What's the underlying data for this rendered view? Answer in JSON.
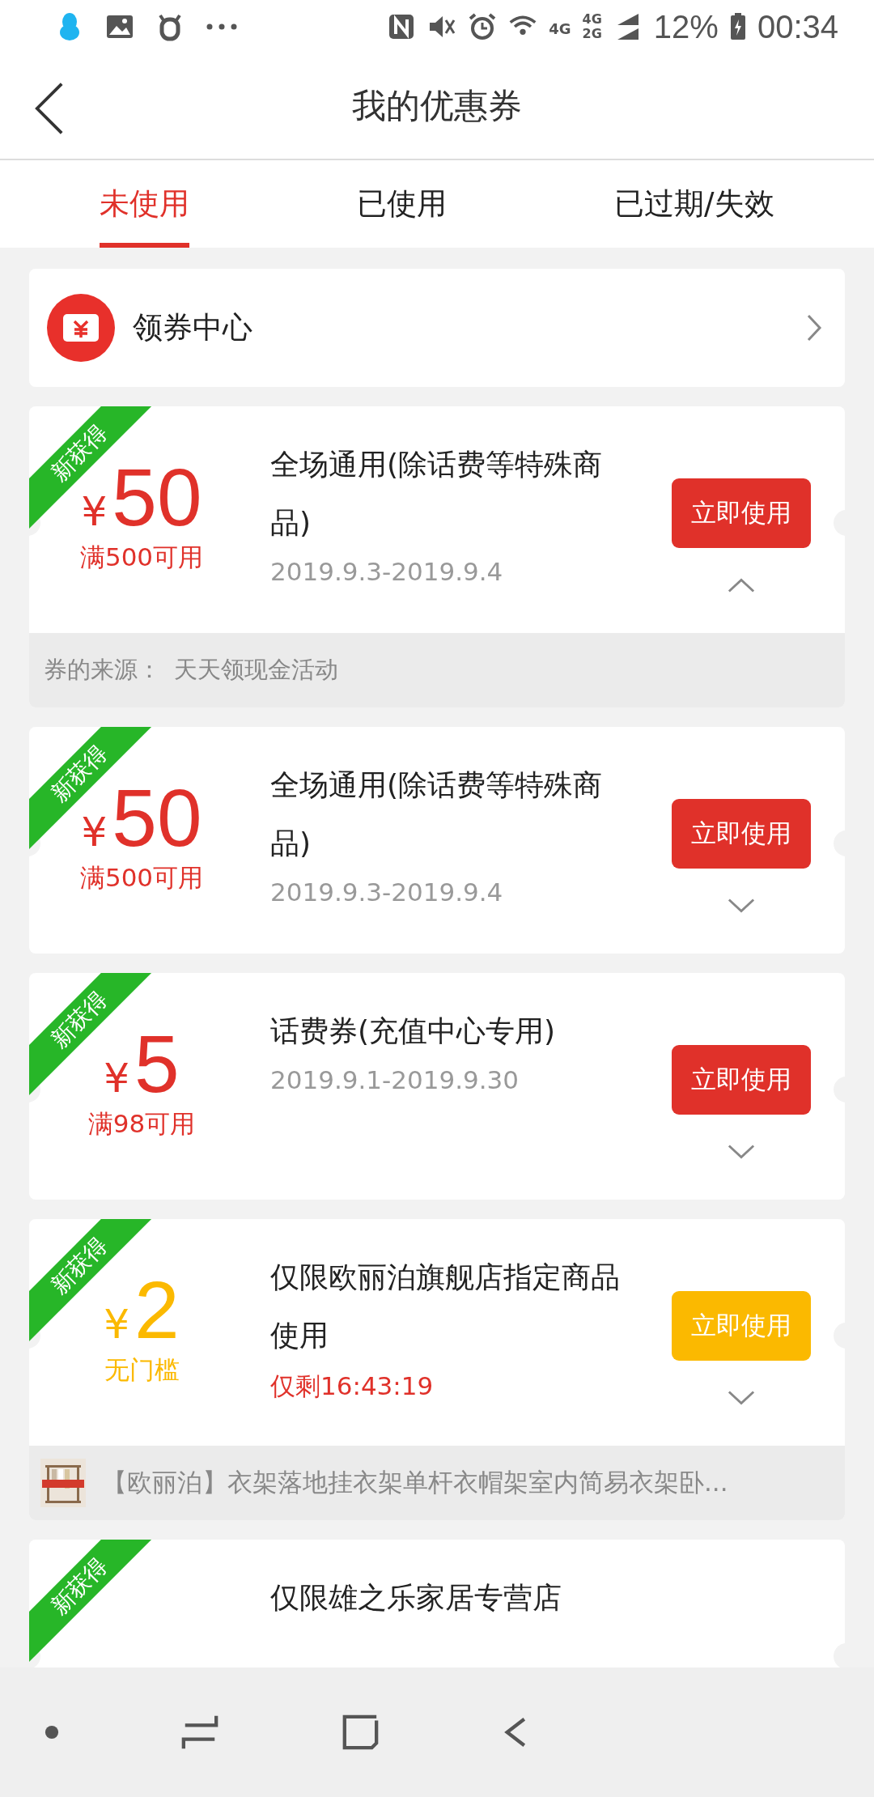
{
  "status_bar": {
    "network_primary": "4G",
    "network_secondary": [
      "4G",
      "2G"
    ],
    "battery": "12%",
    "time": "00:34"
  },
  "header": {
    "title": "我的优惠券"
  },
  "tabs": [
    {
      "label": "未使用",
      "selected": true
    },
    {
      "label": "已使用",
      "selected": false
    },
    {
      "label": "已过期/失效",
      "selected": false
    }
  ],
  "coupon_center": {
    "label": "领券中心"
  },
  "coupons": [
    {
      "badge": "新获得",
      "color": "#e0312a",
      "currency": "¥",
      "amount": "50",
      "condition": "满500可用",
      "title": "全场通用(除话费等特殊商品)",
      "date": "2019.9.3-2019.9.4",
      "button": "立即使用",
      "expanded": true,
      "footer": {
        "kind": "source",
        "label": "券的来源：",
        "value": "天天领现金活动"
      }
    },
    {
      "badge": "新获得",
      "color": "#e0312a",
      "currency": "¥",
      "amount": "50",
      "condition": "满500可用",
      "title": "全场通用(除话费等特殊商品)",
      "date": "2019.9.3-2019.9.4",
      "button": "立即使用",
      "expanded": false
    },
    {
      "badge": "新获得",
      "color": "#e0312a",
      "currency": "¥",
      "amount": "5",
      "condition": "满98可用",
      "title": "话费券(充值中心专用)",
      "date": "2019.9.1-2019.9.30",
      "button": "立即使用",
      "expanded": false
    },
    {
      "badge": "新获得",
      "color": "#fbb900",
      "currency": "¥",
      "amount": "2",
      "condition": "无门槛",
      "title": "仅限欧丽泊旗舰店指定商品使用",
      "countdown": "仅剩16:43:19",
      "button": "立即使用",
      "expanded": false,
      "footer": {
        "kind": "product",
        "text": "【欧丽泊】衣架落地挂衣架单杆衣帽架室内简易衣架卧..."
      }
    },
    {
      "badge": "新获得",
      "title": "仅限雄之乐家居专营店"
    }
  ]
}
